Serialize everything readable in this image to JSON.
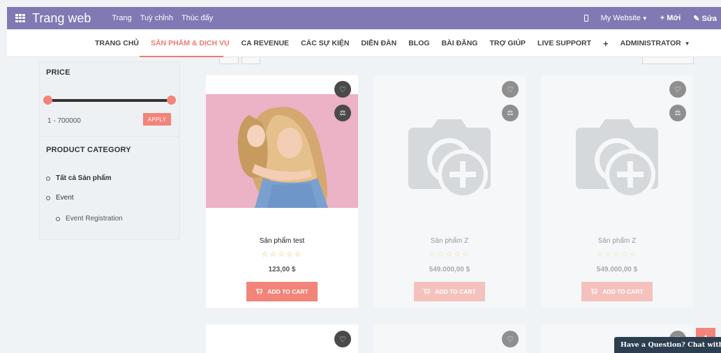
{
  "topbar": {
    "brand": "Trang web",
    "menu": [
      "Trang",
      "Tuỳ chỉnh",
      "Thúc đẩy"
    ],
    "website_label": "My Website",
    "new_label": "+ Mới",
    "edit_label": "Sửa"
  },
  "nav": {
    "items": [
      "TRANG CHỦ",
      "SẢN PHẨM & DỊCH VỤ",
      "CA REVENUE",
      "CÁC SỰ KIỆN",
      "DIỄN ĐÀN",
      "BLOG",
      "BÀI ĐĂNG",
      "TRỢ GIÚP",
      "LIVE SUPPORT",
      "+",
      "ADMINISTRATOR"
    ],
    "active_index": 1
  },
  "sidebar": {
    "price_title": "PRICE",
    "price_range": "1 - 700000",
    "price_min": 1,
    "price_max": 700000,
    "apply_label": "APPLY",
    "category_title": "PRODUCT CATEGORY",
    "categories": [
      {
        "label": "Tất cả Sản phẩm",
        "level": 0
      },
      {
        "label": "Event",
        "level": 0
      },
      {
        "label": "Event Registration",
        "level": 1
      }
    ]
  },
  "products": [
    {
      "name": "Sản phẩm test",
      "stars": "☆☆☆☆☆",
      "price": "123,00 $",
      "cart_label": "ADD TO CART"
    },
    {
      "name": "Sản phẩm Z",
      "stars": "☆☆☆☆☆",
      "price": "549.000,00 $",
      "cart_label": "ADD TO CART"
    },
    {
      "name": "Sản phẩm Z",
      "stars": "☆☆☆☆☆",
      "price": "549.000,00 $",
      "cart_label": "ADD TO CART"
    }
  ],
  "chat": {
    "label": "Have a Question? Chat with us"
  },
  "colors": {
    "topbar": "#8079b3",
    "accent": "#f28479",
    "chat": "#2c3e50"
  }
}
